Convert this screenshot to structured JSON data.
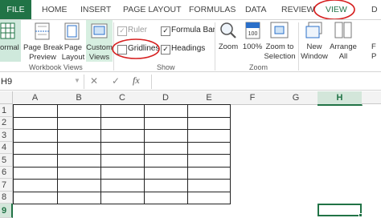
{
  "tabs": [
    "FILE",
    "HOME",
    "INSERT",
    "PAGE LAYOUT",
    "FORMULAS",
    "DATA",
    "REVIEW",
    "VIEW",
    "D"
  ],
  "ribbon": {
    "workbook_views": {
      "normal": "ormal",
      "page_break_1": "Page Break",
      "page_break_2": "Preview",
      "page_layout_1": "Page",
      "page_layout_2": "Layout",
      "custom_views_1": "Custom",
      "custom_views_2": "Views",
      "group_label": "Workbook Views"
    },
    "show": {
      "ruler": "Ruler",
      "formula_bar": "Formula Bar",
      "gridlines": "Gridlines",
      "headings": "Headings",
      "group_label": "Show"
    },
    "zoom": {
      "zoom": "Zoom",
      "hundred": "100%",
      "zoom_sel_1": "Zoom to",
      "zoom_sel_2": "Selection",
      "group_label": "Zoom"
    },
    "window": {
      "new_1": "New",
      "new_2": "Window",
      "arrange_1": "Arrange",
      "arrange_2": "All",
      "freeze_1": "F",
      "freeze_2": "P"
    }
  },
  "formula_bar": {
    "name_box": "H9",
    "cancel": "✕",
    "enter": "✓",
    "fx": "fx"
  },
  "grid": {
    "columns": [
      "A",
      "B",
      "C",
      "D",
      "E",
      "F",
      "G",
      "H"
    ],
    "rows": [
      "1",
      "2",
      "3",
      "4",
      "5",
      "6",
      "7",
      "8",
      "9"
    ]
  },
  "colors": {
    "accent": "#217346",
    "annotation": "#d62020"
  },
  "icons": [
    "normal-view-icon",
    "page-break-icon",
    "page-layout-icon",
    "custom-views-icon",
    "zoom-icon",
    "hundred-percent-icon",
    "zoom-selection-icon",
    "new-window-icon",
    "arrange-all-icon"
  ]
}
